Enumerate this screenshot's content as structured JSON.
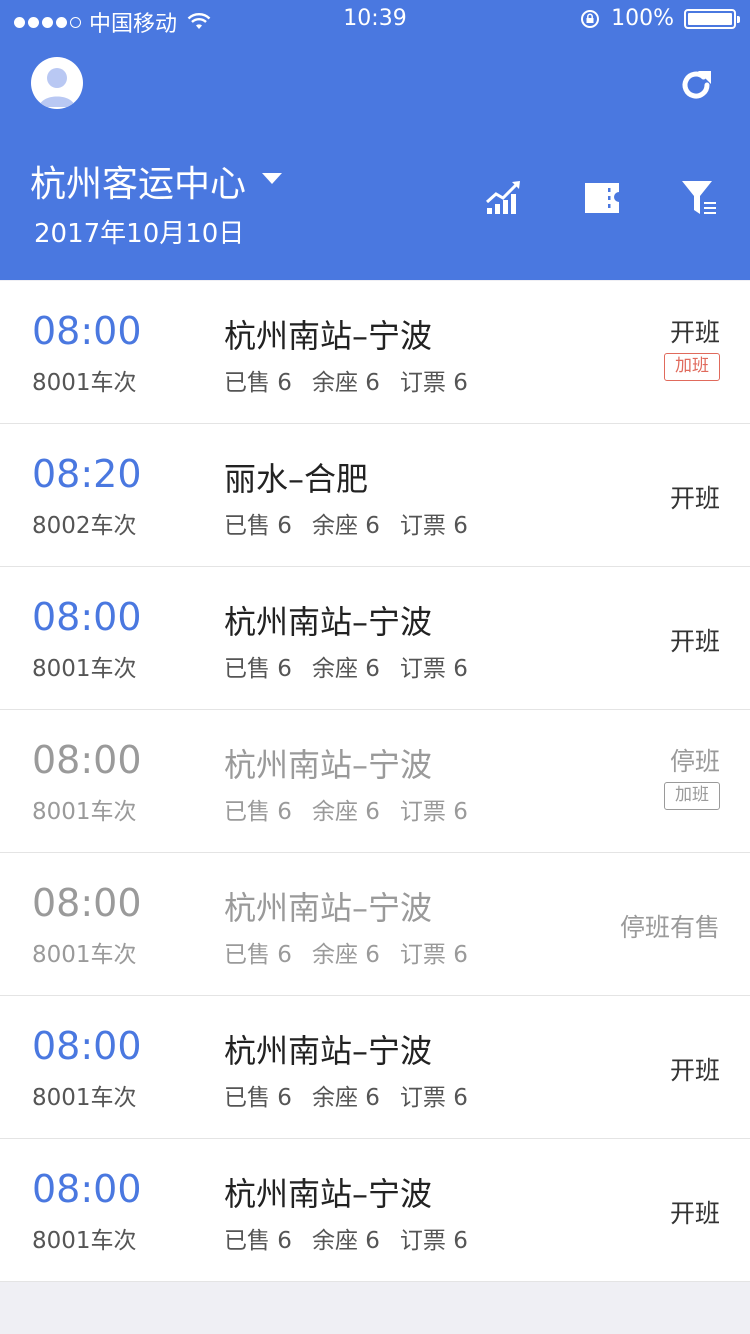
{
  "statusbar": {
    "carrier": "中国移动",
    "time": "10:39",
    "battery": "100%"
  },
  "header": {
    "station": "杭州客运中心",
    "date": "2017年10月10日"
  },
  "schedules": [
    {
      "time": "08:00",
      "trip": "8001车次",
      "route": "杭州南站–宁波",
      "sold": "已售 6",
      "seats": "余座 6",
      "booked": "订票 6",
      "status": "开班",
      "badge": "加班"
    },
    {
      "time": "08:20",
      "trip": "8002车次",
      "route": "丽水–合肥",
      "sold": "已售 6",
      "seats": "余座 6",
      "booked": "订票 6",
      "status": "开班",
      "badge": ""
    },
    {
      "time": "08:00",
      "trip": "8001车次",
      "route": "杭州南站–宁波",
      "sold": "已售 6",
      "seats": "余座 6",
      "booked": "订票 6",
      "status": "开班",
      "badge": ""
    },
    {
      "time": "08:00",
      "trip": "8001车次",
      "route": "杭州南站–宁波",
      "sold": "已售 6",
      "seats": "余座 6",
      "booked": "订票 6",
      "status": "停班",
      "badge": "加班"
    },
    {
      "time": "08:00",
      "trip": "8001车次",
      "route": "杭州南站–宁波",
      "sold": "已售 6",
      "seats": "余座 6",
      "booked": "订票 6",
      "status": "停班有售",
      "badge": ""
    },
    {
      "time": "08:00",
      "trip": "8001车次",
      "route": "杭州南站–宁波",
      "sold": "已售 6",
      "seats": "余座 6",
      "booked": "订票 6",
      "status": "开班",
      "badge": ""
    },
    {
      "time": "08:00",
      "trip": "8001车次",
      "route": "杭州南站–宁波",
      "sold": "已售 6",
      "seats": "余座 6",
      "booked": "订票 6",
      "status": "开班",
      "badge": ""
    }
  ],
  "colors": {
    "accent": "#4a78e0",
    "badge": "#e06a5c",
    "dim": "#9a9a9a"
  },
  "icons": [
    "avatar-icon",
    "refresh-icon",
    "chart-icon",
    "ticket-icon",
    "filter-icon"
  ]
}
